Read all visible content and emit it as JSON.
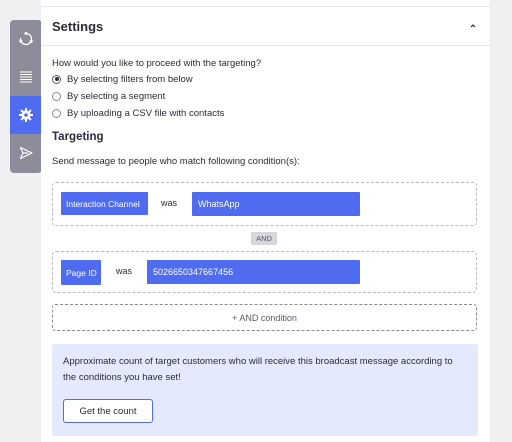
{
  "rail": {
    "items": [
      {
        "icon": "refresh-icon",
        "active": false
      },
      {
        "icon": "list-icon",
        "active": false
      },
      {
        "icon": "gear-icon",
        "active": true
      },
      {
        "icon": "send-icon",
        "active": false
      }
    ]
  },
  "settings": {
    "title": "Settings",
    "question": "How would you like to proceed with the targeting?",
    "options": [
      {
        "label": "By selecting filters from below",
        "checked": true
      },
      {
        "label": "By selecting a segment",
        "checked": false
      },
      {
        "label": "By uploading a CSV file with contacts",
        "checked": false
      }
    ]
  },
  "targeting": {
    "title": "Targeting",
    "description": "Send message to people who match following condition(s):",
    "conditions": [
      {
        "field": "Interaction Channel",
        "operator": "was",
        "value": "WhatsApp"
      },
      {
        "field": "Page ID",
        "operator": "was",
        "value": "5026650347667456"
      }
    ],
    "joiner": "AND",
    "add_condition_label": "+ AND condition"
  },
  "estimate": {
    "text": "Approximate count of target customers who will receive this broadcast message according to the conditions you have set!",
    "button_label": "Get the count"
  },
  "colors": {
    "accent": "#4f6cf0",
    "rail": "#8c8c9a",
    "info_bg": "#e4eafc"
  }
}
